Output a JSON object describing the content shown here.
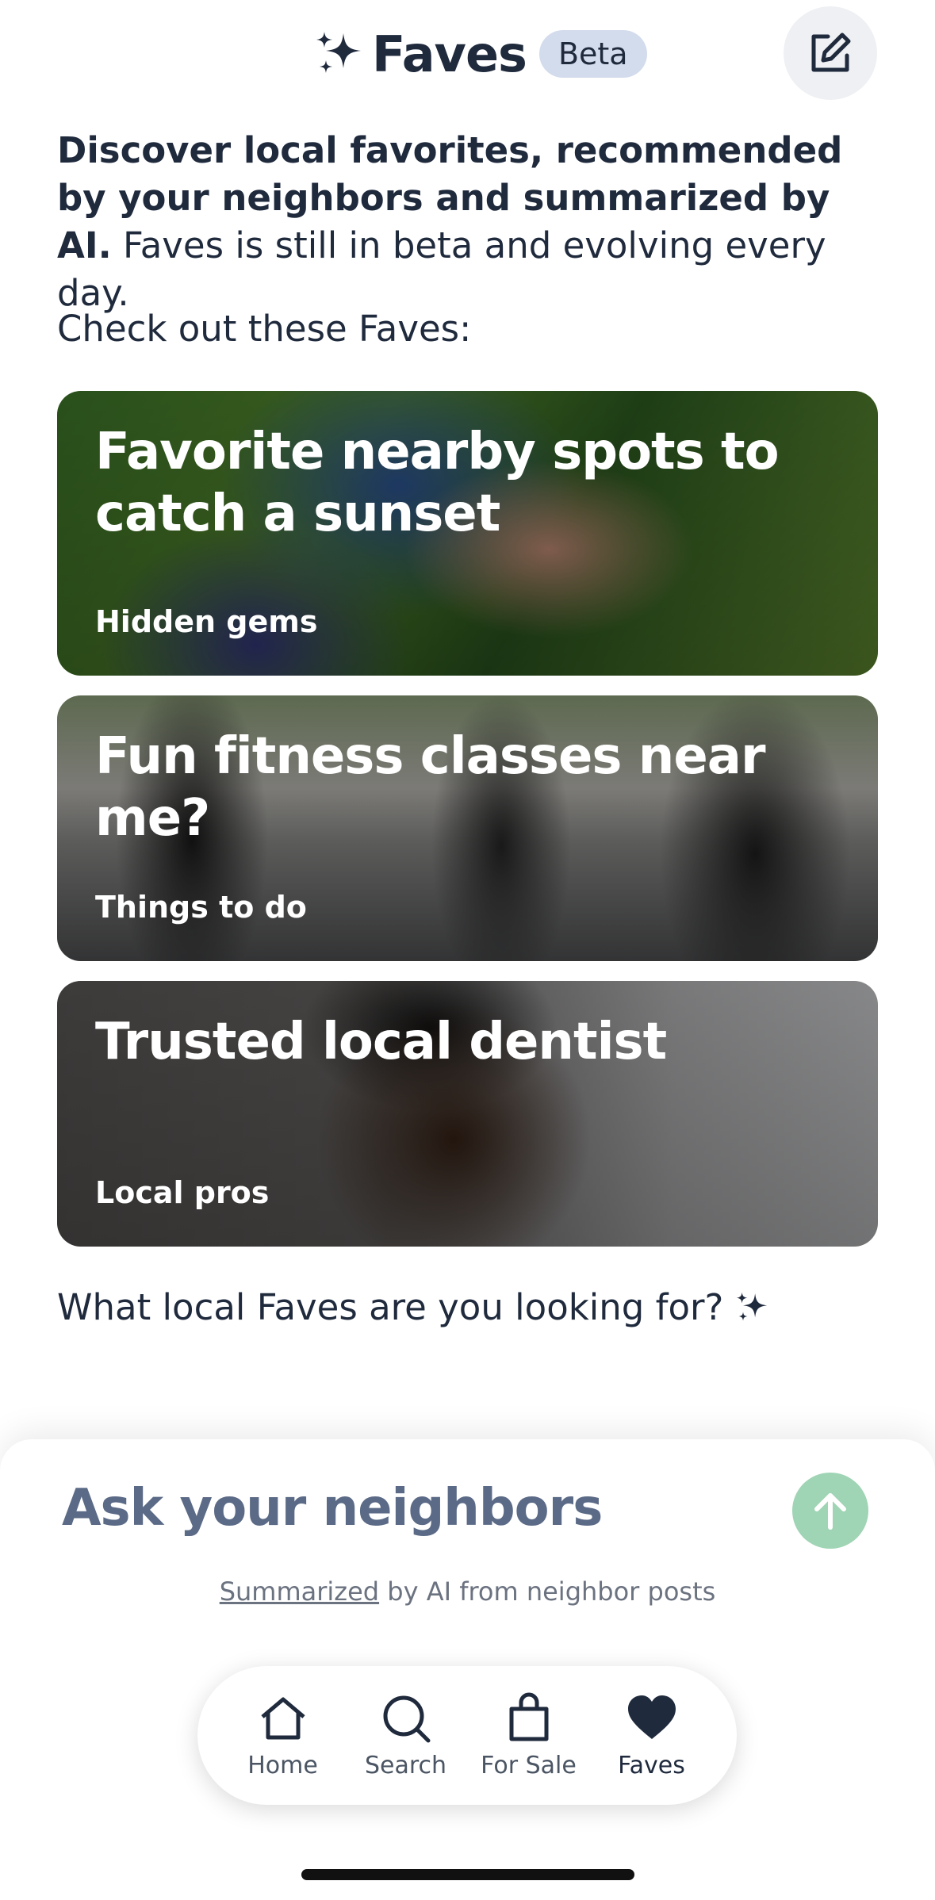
{
  "header": {
    "title": "Faves",
    "badge": "Beta",
    "icons": {
      "title": "sparkle-icon",
      "edit": "edit-icon"
    }
  },
  "intro": {
    "bold_text": "Discover local favorites, recommended by your neighbors and summarized by AI.",
    "regular_text": " Faves is still in beta and evolving every day."
  },
  "check_label": "Check out these Faves:",
  "cards": [
    {
      "title": "Favorite nearby spots to catch a sunset",
      "subtitle": "Hidden gems"
    },
    {
      "title": "Fun fitness classes near me?",
      "subtitle": "Things to do"
    },
    {
      "title": "Trusted local dentist",
      "subtitle": "Local pros"
    }
  ],
  "looking_prompt": "What local Faves are you looking for?",
  "ask": {
    "placeholder": "Ask your neighbors",
    "note_link": "Summarized",
    "note_rest": " by AI from neighbor posts",
    "send_icon": "arrow-up-icon",
    "send_color": "#9fd4b4"
  },
  "nav": {
    "items": [
      {
        "label": "Home",
        "icon": "home-icon"
      },
      {
        "label": "Search",
        "icon": "search-icon"
      },
      {
        "label": "For Sale",
        "icon": "shopping-bag-icon"
      },
      {
        "label": "Faves",
        "icon": "heart-icon",
        "active": true
      }
    ]
  },
  "colors": {
    "text_primary": "#1f2a3d",
    "badge_bg": "#d3dcec",
    "placeholder": "#5b6a86"
  }
}
